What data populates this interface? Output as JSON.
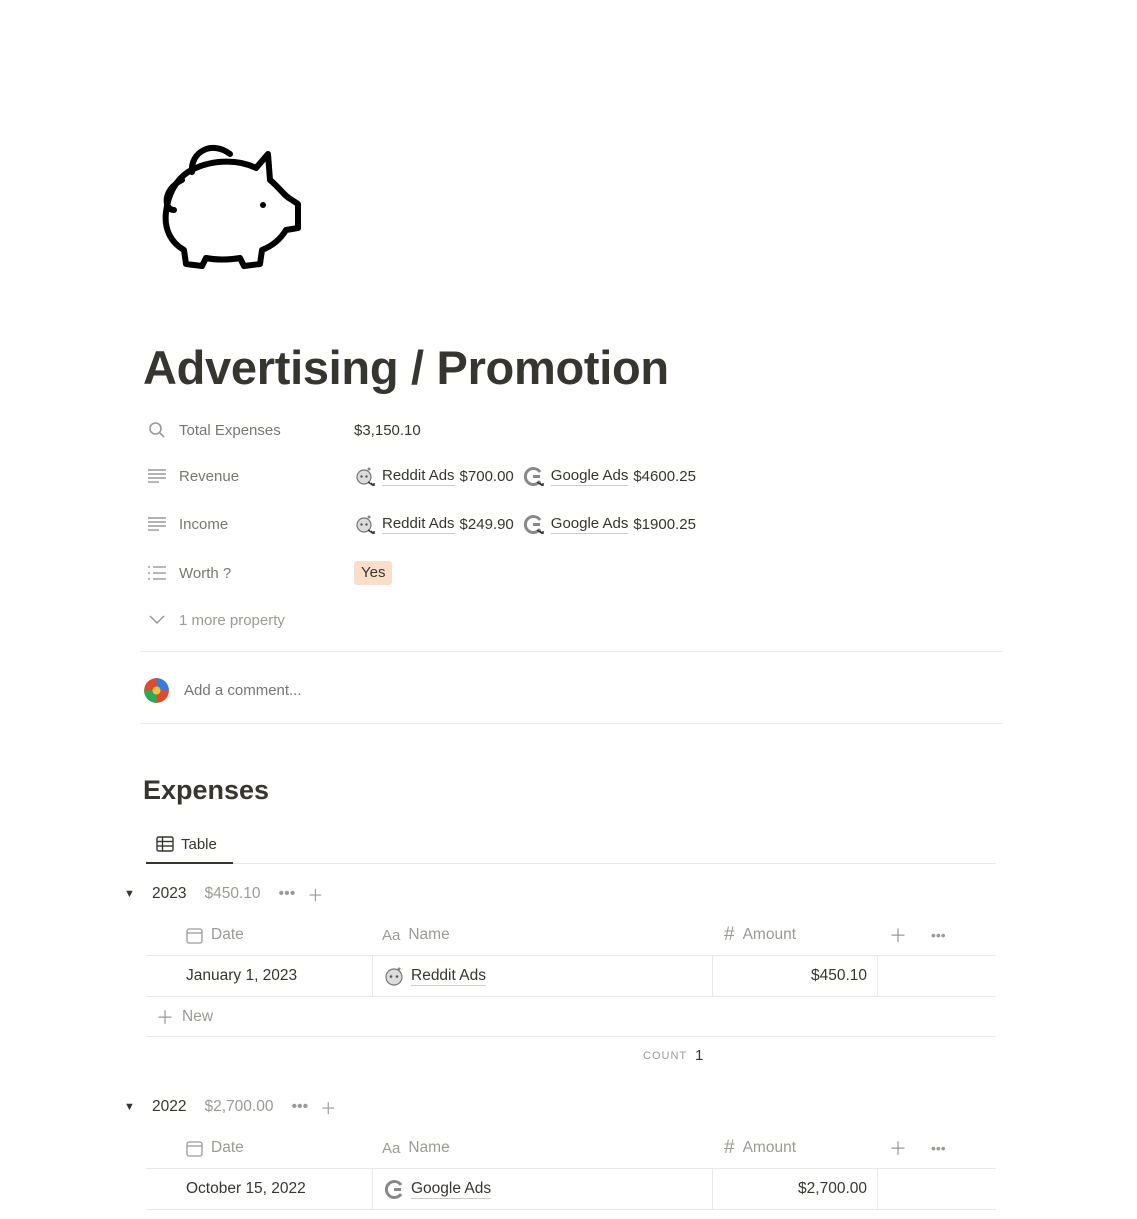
{
  "page": {
    "icon": "piggy-bank-icon",
    "title": "Advertising / Promotion"
  },
  "properties": {
    "total_expenses": {
      "label": "Total Expenses",
      "icon": "search-icon",
      "value": "$3,150.10"
    },
    "revenue": {
      "label": "Revenue",
      "icon": "text-lines-icon",
      "items": [
        {
          "icon": "reddit-icon",
          "name": "Reddit Ads",
          "amount": "$700.00"
        },
        {
          "icon": "google-icon",
          "name": "Google Ads",
          "amount": "$4600.25"
        }
      ]
    },
    "income": {
      "label": "Income",
      "icon": "text-lines-icon",
      "items": [
        {
          "icon": "reddit-icon",
          "name": "Reddit Ads",
          "amount": "$249.90"
        },
        {
          "icon": "google-icon",
          "name": "Google Ads",
          "amount": "$1900.25"
        }
      ]
    },
    "worth": {
      "label": "Worth ?",
      "icon": "list-icon",
      "value": "Yes",
      "tag_color": "#fadec9"
    },
    "more": "1 more property"
  },
  "comment": {
    "placeholder": "Add a comment..."
  },
  "expenses": {
    "title": "Expenses",
    "view_tab": "Table",
    "columns": {
      "date": "Date",
      "name": "Name",
      "amount": "Amount",
      "name_prefix": "Aa",
      "amount_prefix": "#"
    },
    "groups": [
      {
        "year": "2023",
        "sum": "$450.10",
        "rows": [
          {
            "date": "January 1, 2023",
            "icon": "reddit-icon",
            "name": "Reddit Ads",
            "amount": "$450.10"
          }
        ],
        "new_label": "New",
        "count_label": "COUNT",
        "count_value": "1"
      },
      {
        "year": "2022",
        "sum": "$2,700.00",
        "rows": [
          {
            "date": "October 15, 2022",
            "icon": "google-icon",
            "name": "Google Ads",
            "amount": "$2,700.00"
          }
        ]
      }
    ]
  }
}
